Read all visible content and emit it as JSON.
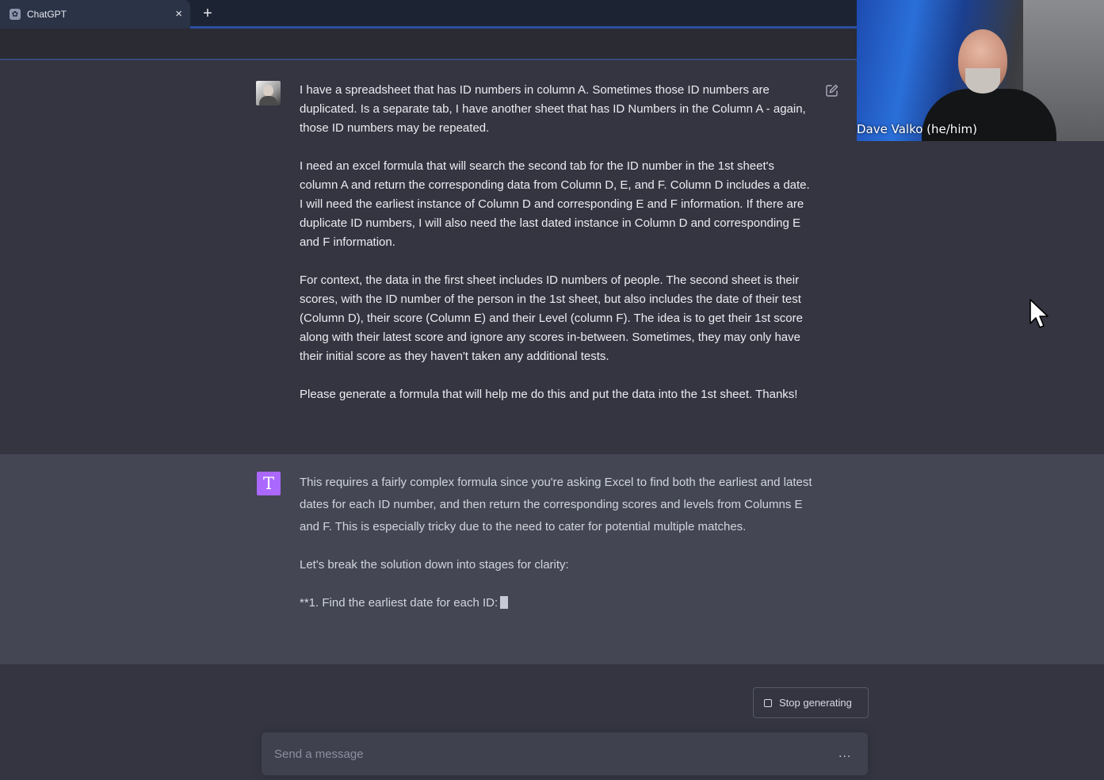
{
  "browser": {
    "tab_title": "ChatGPT",
    "tab_close_glyph": "×",
    "new_tab_glyph": "+"
  },
  "conversation": {
    "user_message": {
      "paragraphs": [
        "I have a spreadsheet that has ID numbers in column A. Sometimes those ID numbers are duplicated. Is a separate tab, I have another sheet that has ID Numbers in the Column A - again, those ID numbers may be repeated.",
        "I need an excel formula that will search the second tab for the ID number in the 1st sheet's column A and return the corresponding data from Column D, E, and F. Column D includes a date. I will need the earliest instance of Column D and corresponding E and F information. If there are duplicate ID numbers, I will also need the last dated instance in Column D and corresponding E and F information.",
        "For context, the data in the first sheet includes ID numbers of people. The second sheet is their scores, with the ID number of the person in the 1st sheet, but also includes the date of their test (Column D), their score (Column E) and their Level (column F). The idea is to get their 1st score along with their latest score and ignore any scores in-between. Sometimes, they may only have their initial score as they haven't taken any additional tests.",
        "Please generate a formula that will help me do this and put the data into the 1st sheet. Thanks!"
      ]
    },
    "assistant_message": {
      "avatar_letter": "T",
      "paragraphs": [
        "This requires a fairly complex formula since you're asking Excel to find both the earliest and latest dates for each ID number, and then return the corresponding scores and levels from Columns E and F. This is especially tricky due to the need to cater for potential multiple matches.",
        "Let's break the solution down into stages for clarity:",
        "**1. Find the earliest date for each ID:"
      ]
    }
  },
  "controls": {
    "stop_label": "Stop generating",
    "input_placeholder": "Send a message",
    "input_value": "",
    "dots": "..."
  },
  "video": {
    "participant_name": "Dave Valko (he/him)"
  },
  "colors": {
    "page_bg": "#343541",
    "assistant_bg": "#444654",
    "assistant_avatar": "#ab68ff",
    "composer_bg": "#40414f"
  }
}
